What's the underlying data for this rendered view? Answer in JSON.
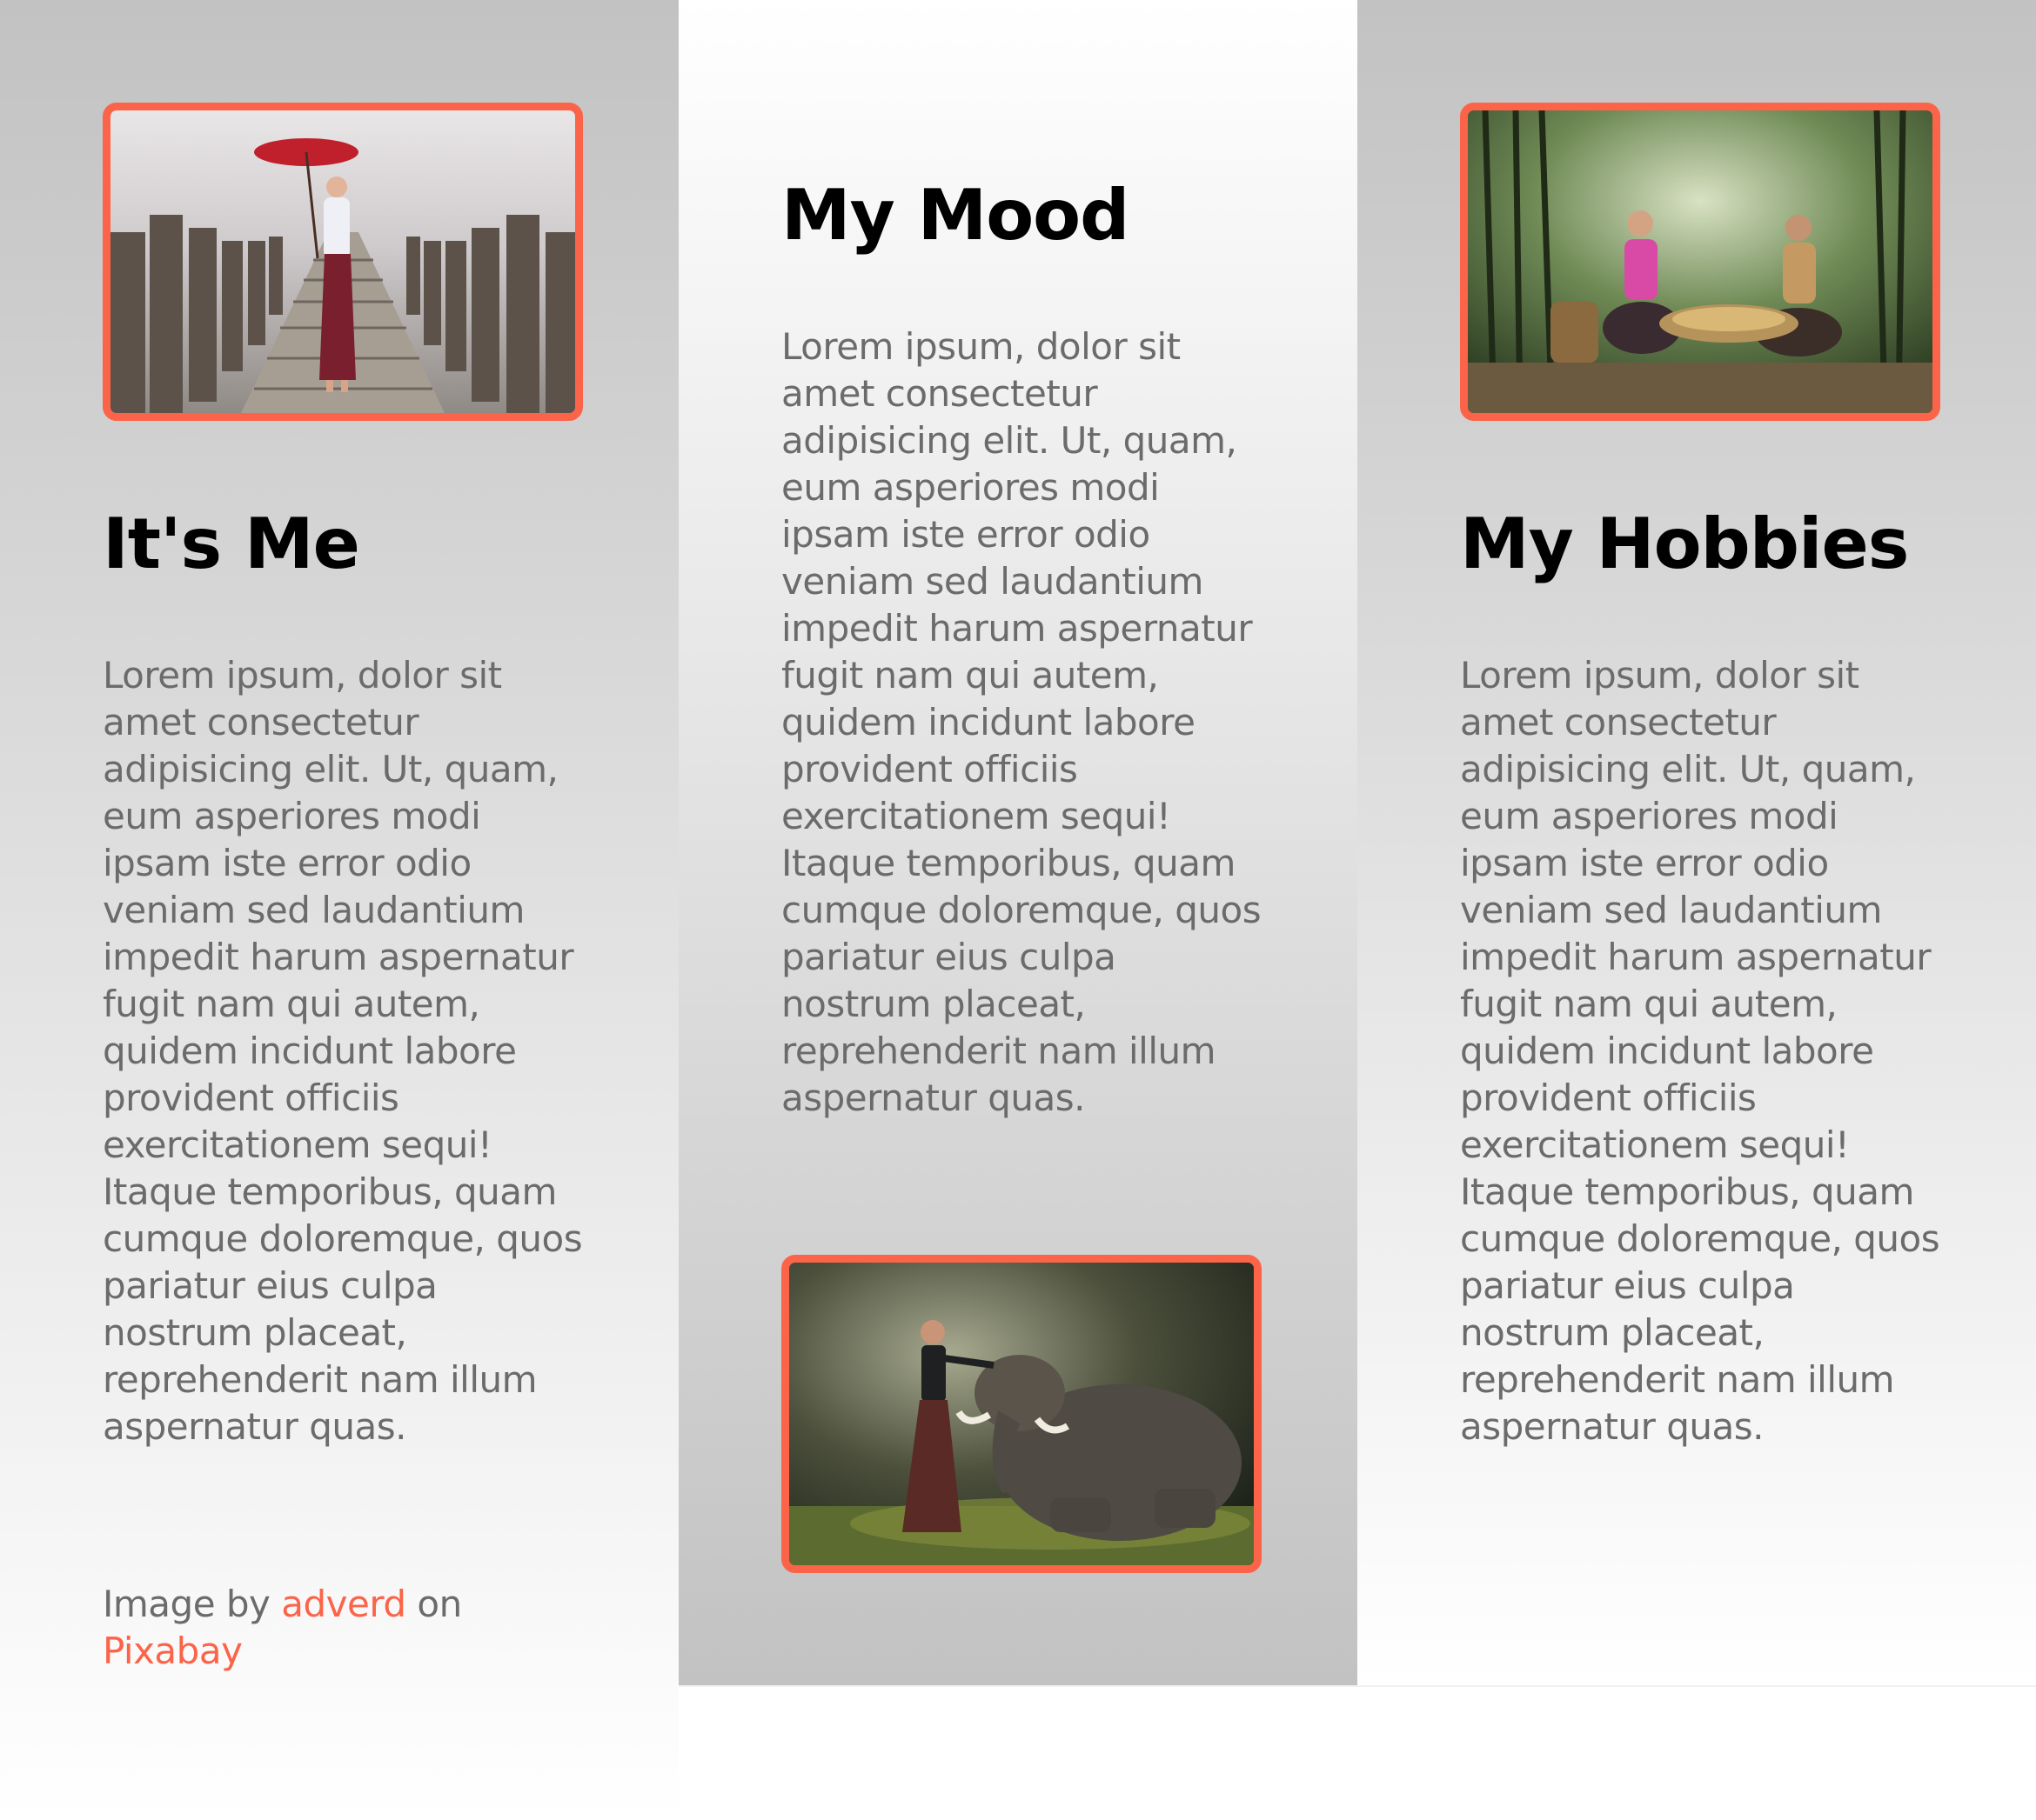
{
  "columns": [
    {
      "heading": "It's Me",
      "body": "Lorem ipsum, dolor sit amet consectetur adipisicing elit. Ut, quam, eum asperiores modi ipsam iste error odio veniam sed laudantium impedit harum aspernatur fugit nam qui autem, quidem incidunt labore provident officiis exercitationem sequi! Itaque temporibus, quam cumque doloremque, quos pariatur eius culpa nostrum placeat, reprehenderit nam illum aspernatur quas.",
      "image_icon": "woman-with-red-umbrella-on-bridge-photo"
    },
    {
      "heading": "My Mood",
      "body": "Lorem ipsum, dolor sit amet consectetur adipisicing elit. Ut, quam, eum asperiores modi ipsam iste error odio veniam sed laudantium impedit harum aspernatur fugit nam qui autem, quidem incidunt labore provident officiis exercitationem sequi! Itaque temporibus, quam cumque doloremque, quos pariatur eius culpa nostrum placeat, reprehenderit nam illum aspernatur quas.",
      "image_icon": "girl-with-elephant-photo"
    },
    {
      "heading": "My Hobbies",
      "body": "Lorem ipsum, dolor sit amet consectetur adipisicing elit. Ut, quam, eum asperiores modi ipsam iste error odio veniam sed laudantium impedit harum aspernatur fugit nam qui autem, quidem incidunt labore provident officiis exercitationem sequi! Itaque temporibus, quam cumque doloremque, quos pariatur eius culpa nostrum placeat, reprehenderit nam illum aspernatur quas.",
      "image_icon": "women-sifting-grain-in-forest-photo"
    }
  ],
  "credit": {
    "prefix": "Image by",
    "author": "adverd",
    "middle": "on",
    "site": "Pixabay"
  },
  "colors": {
    "accent": "#fb6449",
    "heading": "#000000",
    "body_text": "#6b6b6b",
    "gradient_gray": "#c2c2c2",
    "gradient_white": "#ffffff"
  }
}
